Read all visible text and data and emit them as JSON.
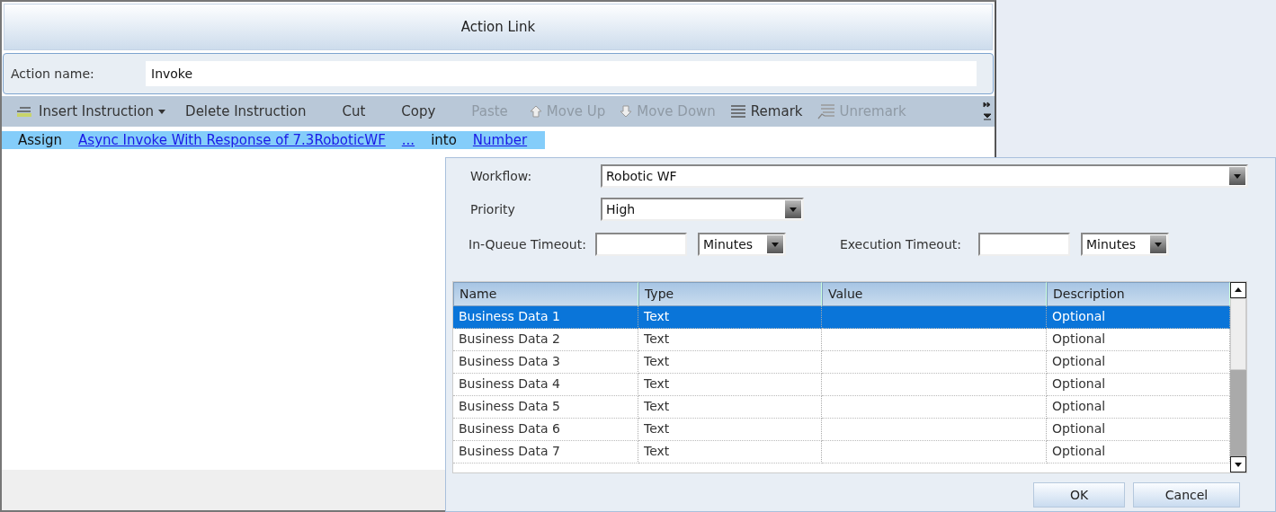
{
  "window": {
    "title": "Action Link"
  },
  "action_name": {
    "label": "Action name:",
    "value": "Invoke"
  },
  "toolbar": [
    {
      "label": "Insert Instruction",
      "kind": "insert",
      "disabled": false
    },
    {
      "label": "Delete Instruction",
      "kind": "plain",
      "disabled": false
    },
    {
      "label": "Cut",
      "kind": "plain",
      "disabled": false
    },
    {
      "label": "Copy",
      "kind": "plain",
      "disabled": false
    },
    {
      "label": "Paste",
      "kind": "plain",
      "disabled": true
    },
    {
      "label": "Move Up",
      "kind": "up",
      "disabled": true
    },
    {
      "label": "Move Down",
      "kind": "down",
      "disabled": true
    },
    {
      "label": "Remark",
      "kind": "remark",
      "disabled": false
    },
    {
      "label": "Unremark",
      "kind": "unremark",
      "disabled": true
    }
  ],
  "instruction": [
    {
      "text": "Assign",
      "kind": "text"
    },
    {
      "text": "Async Invoke With Response of 7.3RoboticWF",
      "kind": "link"
    },
    {
      "text": "...",
      "kind": "link"
    },
    {
      "text": "into",
      "kind": "text"
    },
    {
      "text": "Number",
      "kind": "link"
    }
  ],
  "dialog": {
    "workflow": {
      "label": "Workflow:",
      "value": "Robotic WF"
    },
    "priority": {
      "label": "Priority",
      "value": "High"
    },
    "in_queue_timeout": {
      "label": "In-Queue Timeout:",
      "unit": "Minutes"
    },
    "execution_timeout": {
      "label": "Execution Timeout:",
      "unit": "Minutes"
    },
    "table": {
      "columns": [
        "Name",
        "Type",
        "Value",
        "Description"
      ],
      "rows": [
        {
          "name": "Business Data 1",
          "type": "Text",
          "description": "Optional",
          "selected": true
        },
        {
          "name": "Business Data 2",
          "type": "Text",
          "description": "Optional",
          "selected": false
        },
        {
          "name": "Business Data 3",
          "type": "Text",
          "description": "Optional",
          "selected": false
        },
        {
          "name": "Business Data 4",
          "type": "Text",
          "description": "Optional",
          "selected": false
        },
        {
          "name": "Business Data 5",
          "type": "Text",
          "description": "Optional",
          "selected": false
        },
        {
          "name": "Business Data 6",
          "type": "Text",
          "description": "Optional",
          "selected": false
        },
        {
          "name": "Business Data 7",
          "type": "Text",
          "description": "Optional",
          "selected": false
        }
      ]
    },
    "buttons": [
      "OK",
      "Cancel"
    ]
  }
}
